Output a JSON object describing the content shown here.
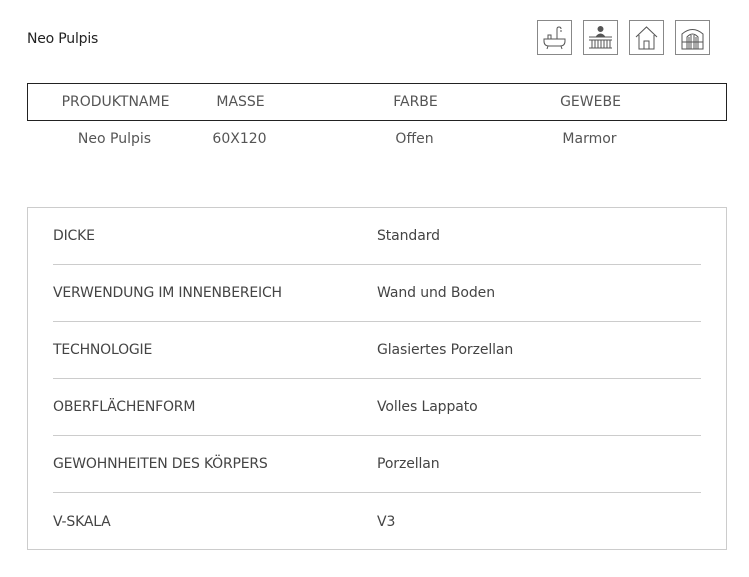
{
  "product": {
    "title": "Neo Pulpis"
  },
  "icons": [
    {
      "name": "bathroom-icon"
    },
    {
      "name": "balcony-icon"
    },
    {
      "name": "home-icon"
    },
    {
      "name": "facade-icon"
    }
  ],
  "summary": {
    "headers": [
      "PRODUKTNAME",
      "MASSE",
      "FARBE",
      "GEWEBE"
    ],
    "values": [
      "Neo Pulpis",
      "60X120",
      "Offen",
      "Marmor"
    ]
  },
  "specs": [
    {
      "label": "DICKE",
      "value": "Standard"
    },
    {
      "label": "VERWENDUNG IM INNENBEREICH",
      "value": "Wand und Boden"
    },
    {
      "label": "TECHNOLOGIE",
      "value": "Glasiertes Porzellan"
    },
    {
      "label": "OBERFLÄCHENFORM",
      "value": "Volles Lappato"
    },
    {
      "label": "GEWOHNHEITEN DES KÖRPERS",
      "value": "Porzellan"
    },
    {
      "label": "V-SKALA",
      "value": "V3"
    }
  ]
}
